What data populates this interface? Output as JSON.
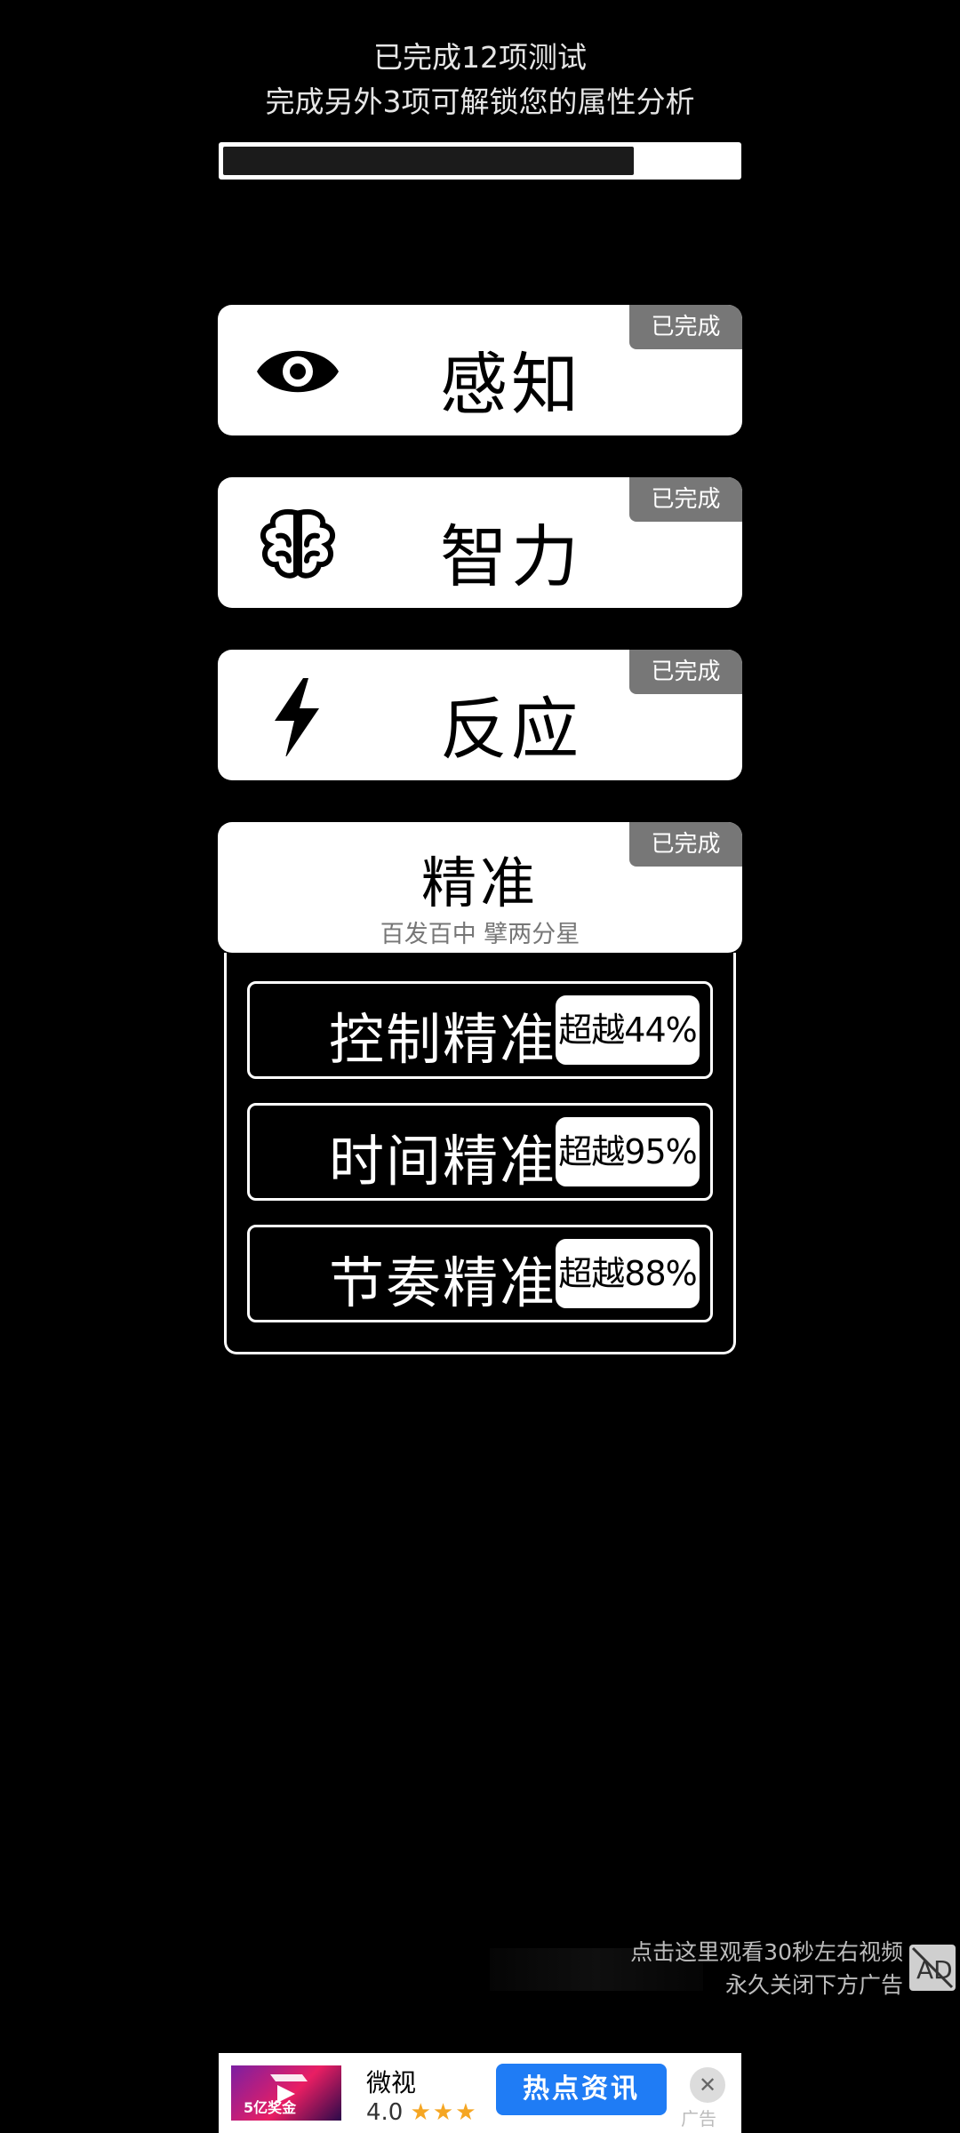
{
  "header": {
    "line1": "已完成12项测试",
    "line2": "完成另外3项可解锁您的属性分析",
    "progress": 0.8
  },
  "cards": [
    {
      "title": "感知",
      "badge": "已完成",
      "icon": "eye-icon"
    },
    {
      "title": "智力",
      "badge": "已完成",
      "icon": "brain-icon"
    },
    {
      "title": "反应",
      "badge": "已完成",
      "icon": "lightning-icon"
    },
    {
      "title": "精准",
      "badge": "已完成",
      "subtitle": "百发百中 擘两分星"
    }
  ],
  "stats": [
    {
      "name": "控制精准",
      "value": "超越44%"
    },
    {
      "name": "时间精准",
      "value": "超越95%"
    },
    {
      "name": "节奏精准",
      "value": "超越88%"
    }
  ],
  "ad": {
    "hint_line1": "点击这里观看30秒左右视频",
    "hint_line2": "永久关闭下方广告",
    "close_icon": "ad-close-icon",
    "banner": {
      "app_name": "微视",
      "rating": "4.0",
      "stars": "★★★",
      "cta": "热点资讯",
      "thumb_text": "5亿奖金",
      "label": "广告"
    }
  }
}
